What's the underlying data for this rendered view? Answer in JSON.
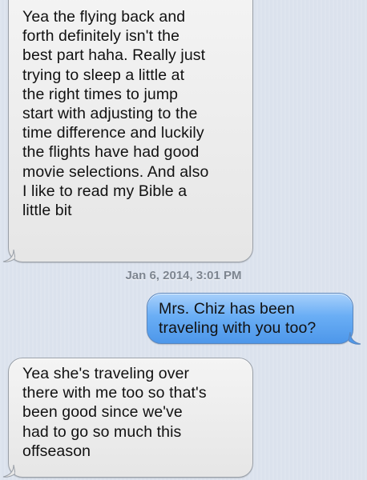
{
  "messages": [
    {
      "direction": "incoming",
      "text": "Yea the flying back and\nforth definitely isn't the\nbest part haha. Really just\ntrying to sleep a little at\nthe right times to jump\nstart with adjusting to the\ntime difference and luckily\nthe flights have had good\nmovie selections. And also\nI like to read my Bible a\nlittle bit"
    },
    {
      "direction": "outgoing",
      "text": "Mrs. Chiz has been\ntraveling with you too?"
    },
    {
      "direction": "incoming",
      "text": "Yea she's traveling over\nthere with me too so that's\nbeen good since we've\nhad to go so much this\noffseason"
    }
  ],
  "timestamp": "Jan 6, 2014, 3:01 PM",
  "colors": {
    "background": "#dbe2ed",
    "incoming_bubble": "#ececec",
    "outgoing_bubble": "#6aaef5",
    "timestamp_text": "#7d8590"
  }
}
